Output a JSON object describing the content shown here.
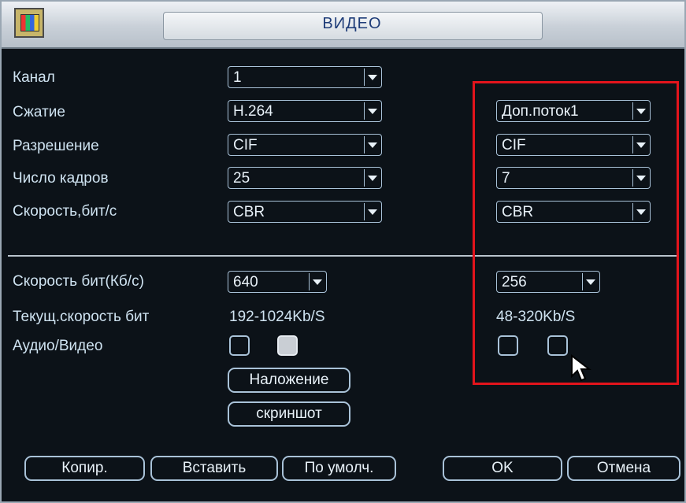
{
  "window": {
    "title": "ВИДЕО"
  },
  "labels": {
    "channel": "Канал",
    "compression": "Сжатие",
    "resolution": "Разрешение",
    "frame_rate": "Число кадров",
    "bitrate_type": "Скорость,бит/с",
    "bitrate": "Скорость бит(Кб/с)",
    "current_bitrate": "Текущ.скорость бит",
    "audio_video": "Аудио/Видео"
  },
  "main_stream": {
    "channel": "1",
    "compression": "H.264",
    "resolution": "CIF",
    "frame_rate": "25",
    "bitrate_type": "CBR",
    "bitrate": "640",
    "current_bitrate": "192-1024Kb/S",
    "audio_checked": false,
    "video_checked": true
  },
  "extra_stream": {
    "stream": "Доп.поток1",
    "resolution": "CIF",
    "frame_rate": "7",
    "bitrate_type": "CBR",
    "bitrate": "256",
    "current_bitrate": "48-320Kb/S",
    "audio_checked": false,
    "video_checked": false
  },
  "buttons": {
    "overlay": "Наложение",
    "snapshot": "скриншот",
    "copy": "Копир.",
    "paste": "Вставить",
    "default": "По умолч.",
    "ok": "OK",
    "cancel": "Отмена"
  },
  "colors": {
    "highlight": "#e3141c",
    "accent": "#a9c2d8",
    "title_text": "#1e3c78"
  }
}
